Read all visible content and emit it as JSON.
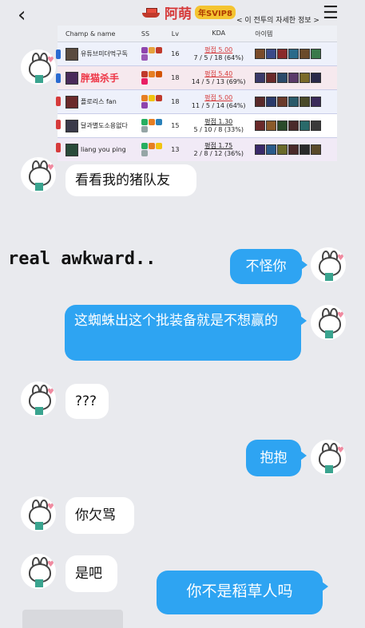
{
  "header": {
    "back_icon": "chevron-left-icon",
    "title": "阿萌",
    "vip_badge": "年SVIP8",
    "subtitle": "< 이 전투의 자세한 정보 >",
    "menu_icon": "menu-icon"
  },
  "game_table": {
    "headers": [
      "Champ & name",
      "SS",
      "Lv",
      "KDA",
      "아이템"
    ],
    "rows": [
      {
        "name": "유튜브미더먹구독",
        "lv": "16",
        "kda_main": "평점 5.00",
        "kda_detail": "7 / 5 / 18 (64%)"
      },
      {
        "name": "胖猫杀手",
        "lv": "18",
        "kda_main": "평점 5.40",
        "kda_detail": "14 / 5 / 13 (69%)"
      },
      {
        "name": "플로리스 fan",
        "lv": "18",
        "kda_main": "평점 5.00",
        "kda_detail": "11 / 5 / 14 (64%)"
      },
      {
        "name": "달과별도소용없다",
        "lv": "15",
        "kda_main": "평점 1.30",
        "kda_detail": "5 / 10 / 8 (33%)"
      },
      {
        "name": "liang you ping",
        "lv": "13",
        "kda_main": "평점 1.75",
        "kda_detail": "2 / 8 / 12 (36%)"
      }
    ]
  },
  "overlay_text": "real awkward..",
  "messages": [
    {
      "side": "left",
      "text": "看看我的猪队友"
    },
    {
      "side": "right",
      "text": "不怪你"
    },
    {
      "side": "right",
      "text": "这蜘蛛出这个批装备就是不想赢的"
    },
    {
      "side": "left",
      "text": "???"
    },
    {
      "side": "right",
      "text": "抱抱"
    },
    {
      "side": "left",
      "text": "你欠骂"
    },
    {
      "side": "left",
      "text": "是吧"
    },
    {
      "side": "right",
      "text": "你不是稻草人吗"
    }
  ],
  "colors": {
    "right_bubble": "#2ea4f2",
    "left_bubble": "#ffffff",
    "title_red": "#d63b3b",
    "background": "#e9eaee"
  }
}
